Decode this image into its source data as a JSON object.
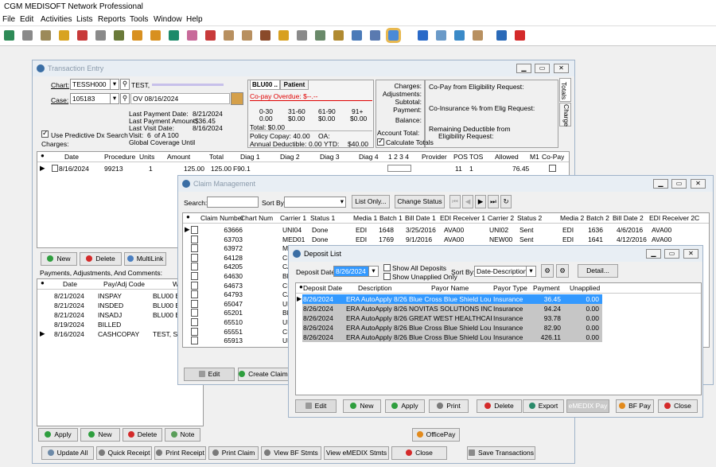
{
  "app": {
    "title": "CGM MEDISOFT Network Professional"
  },
  "menu": [
    "File",
    "Edit",
    "Activities",
    "Lists",
    "Reports",
    "Tools",
    "Window",
    "Help"
  ],
  "toolbar_icons": [
    "quick-ledger-icon",
    "transaction-entry-icon",
    "claim-management-icon",
    "statement-icon",
    "collection-icon",
    "appointment-icon",
    "patient-icon",
    "insurance-icon",
    "address-icon",
    "procedure-icon",
    "diagnosis-icon",
    "provider-icon",
    "referring-icon",
    "billing-code-icon",
    "clipboard-icon",
    "group-icon",
    "tools-icon",
    "calculator-icon",
    "deposit-icon",
    "report-icon",
    "reminder-icon",
    "office-icon",
    "help-icon",
    "document-icon",
    "office-link-icon",
    "export-icon",
    "internet-icon",
    "exit-icon"
  ],
  "te": {
    "title": "Transaction Entry",
    "chart_label": "Chart:",
    "chart_value": "TESSH000",
    "patient_name": "TEST,",
    "case_label": "Case:",
    "case_value": "105183",
    "case_desc": "OV 08/16/2024",
    "last_payment_date_label": "Last Payment Date:",
    "last_payment_date": "8/21/2024",
    "last_payment_amount_label": "Last Payment Amount:",
    "last_payment_amount": "-$36.45",
    "last_visit_date_label": "Last Visit Date:",
    "last_visit_date": "8/16/2024",
    "visit_label": "Visit:",
    "visit_num": "6",
    "visit_of": "of A 100",
    "global_coverage": "Global Coverage Until",
    "predictive_label": "Use Predictive Dx Search",
    "charges_label": "Charges:",
    "tab_blu": "BLU00 ..",
    "tab_patient": "Patient",
    "copay_overdue": "Co-pay Overdue: $--.--",
    "aging_headers": [
      "0-30",
      "31-60",
      "61-90",
      "91+"
    ],
    "aging_values": [
      "0.00",
      "$0.00",
      "$0.00",
      "$0.00"
    ],
    "total": "Total: $0.00",
    "policy_copay": "Policy Copay: 40.00",
    "oa": "OA:",
    "annual_deductible": "Annual Deductible:",
    "deductible_value": "0.00",
    "ytd": "YTD:",
    "ytd_value": "$40.00",
    "sum_labels": [
      "Charges:",
      "Adjustments:",
      "Subtotal:",
      "Payment:",
      "Balance:"
    ],
    "account_total": "Account Total:",
    "calculate_totals": "Calculate Totals",
    "elig1": "Co-Pay from Eligibility Request:",
    "elig2": "Co-Insurance % from Elig Request:",
    "elig3": "Remaining Deductible from",
    "elig4": "Eligibility Request:",
    "side_tab_totals": "Totals",
    "side_tab_charge": "Charge",
    "charge_headers": [
      "Date",
      "Procedure",
      "Units",
      "Amount",
      "Total",
      "Diag 1",
      "Diag 2",
      "Diag 3",
      "Diag 4",
      "1 2 3 4",
      "Provider",
      "POS",
      "TOS",
      "Allowed",
      "M1",
      "Co-Pay"
    ],
    "charge_row": {
      "date": "8/16/2024",
      "procedure": "99213",
      "units": "1",
      "amount": "125.00",
      "total": "125.00",
      "diag1": "F90.1",
      "pos": "11",
      "tos": "1",
      "allowed": "76.45"
    },
    "charge_buttons": [
      "New",
      "Delete",
      "MultiLink"
    ],
    "payments_label": "Payments, Adjustments, And Comments:",
    "payment_headers": [
      "Date",
      "Pay/Adj Code",
      "W"
    ],
    "payments": [
      {
        "date": "8/21/2024",
        "code": "INSPAY",
        "who": "BLU00 BL"
      },
      {
        "date": "8/21/2024",
        "code": "INSDED",
        "who": "BLU00 BL"
      },
      {
        "date": "8/21/2024",
        "code": "INSADJ",
        "who": "BLU00 BL"
      },
      {
        "date": "8/19/2024",
        "code": "BILLED",
        "who": ""
      },
      {
        "date": "8/16/2024",
        "code": "CASHCOPAY",
        "who": "TEST, SH"
      }
    ],
    "payment_buttons": [
      "Apply",
      "New",
      "Delete",
      "Note"
    ],
    "officepay": "OfficePay",
    "bottom_buttons": [
      "Update All",
      "Quick Receipt",
      "Print Receipt",
      "Print Claim",
      "View BF Stmts",
      "View eMEDIX Stmts",
      "Close",
      "Save Transactions"
    ]
  },
  "cm": {
    "title": "Claim Management",
    "search_label": "Search:",
    "sortby_label": "Sort By:",
    "list_only": "List Only...",
    "change_status": "Change Status",
    "headers": [
      "Claim Number",
      "Chart Num",
      "Carrier 1",
      "Status 1",
      "Media 1",
      "Batch 1",
      "Bill Date 1",
      "EDI Receiver 1",
      "Carrier 2",
      "Status 2",
      "Media 2",
      "Batch 2",
      "Bill Date 2",
      "EDI Receiver 2",
      "C"
    ],
    "rows": [
      {
        "claim": "63666",
        "carrier1": "UNI04",
        "status1": "Done",
        "media1": "EDI",
        "batch1": "1648",
        "bill1": "3/25/2016",
        "edi1": "AVA00",
        "carrier2": "UNI02",
        "status2": "Sent",
        "media2": "EDI",
        "batch2": "1636",
        "bill2": "4/6/2016",
        "edi2": "AVA00"
      },
      {
        "claim": "63703",
        "carrier1": "MED01",
        "status1": "Done",
        "media1": "EDI",
        "batch1": "1769",
        "bill1": "9/1/2016",
        "edi1": "AVA00",
        "carrier2": "NEW00",
        "status2": "Sent",
        "media2": "EDI",
        "batch2": "1641",
        "bill2": "4/12/2016",
        "edi2": "AVA00"
      },
      {
        "claim": "63972",
        "carrier1": "ME"
      },
      {
        "claim": "64128",
        "carrier1": "CIC"
      },
      {
        "claim": "64205",
        "carrier1": "CA"
      },
      {
        "claim": "64630",
        "carrier1": "BL"
      },
      {
        "claim": "64673",
        "carrier1": "CIC"
      },
      {
        "claim": "64793",
        "carrier1": "CA"
      },
      {
        "claim": "65047",
        "carrier1": "UN"
      },
      {
        "claim": "65201",
        "carrier1": "BL"
      },
      {
        "claim": "65510",
        "carrier1": "UN"
      },
      {
        "claim": "65551",
        "carrier1": "CIC"
      },
      {
        "claim": "65913",
        "carrier1": "UB"
      }
    ],
    "edit": "Edit",
    "create_claims": "Create Claims"
  },
  "dl": {
    "title": "Deposit List",
    "deposit_date_label": "Deposit Date:",
    "deposit_date": "8/26/2024",
    "show_all": "Show All Deposits",
    "show_unapplied": "Show Unapplied Only",
    "sortby_label": "Sort By:",
    "sortby_value": "Date-Description",
    "detail": "Detail...",
    "headers": [
      "Deposit Date",
      "Description",
      "Payor Name",
      "Payor Type",
      "Payment",
      "Unapplied"
    ],
    "rows": [
      {
        "date": "8/26/2024",
        "desc": "ERA AutoApply 8/26/20",
        "payor": "Blue Cross Blue Shield Louisia",
        "type": "Insurance",
        "payment": "36.45",
        "unapplied": "0.00"
      },
      {
        "date": "8/26/2024",
        "desc": "ERA AutoApply 8/26/20",
        "payor": "NOVITAS SOLUTIONS INC",
        "type": "Insurance",
        "payment": "94.24",
        "unapplied": "0.00"
      },
      {
        "date": "8/26/2024",
        "desc": "ERA AutoApply 8/26/20",
        "payor": "GREAT WEST HEALTHCARE",
        "type": "Insurance",
        "payment": "93.78",
        "unapplied": "0.00"
      },
      {
        "date": "8/26/2024",
        "desc": "ERA AutoApply 8/26/20",
        "payor": "Blue Cross Blue Shield Louisia",
        "type": "Insurance",
        "payment": "82.90",
        "unapplied": "0.00"
      },
      {
        "date": "8/26/2024",
        "desc": "ERA AutoApply 8/26/20",
        "payor": "Blue Cross Blue Shield Louisia",
        "type": "Insurance",
        "payment": "426.11",
        "unapplied": "0.00"
      }
    ],
    "buttons": [
      "Edit",
      "New",
      "Apply",
      "Print",
      "Delete",
      "Export",
      "eMEDIX Pay",
      "BF Pay",
      "Close"
    ]
  },
  "colors": {
    "selected_row": "#3399ff",
    "row_gray": "#c6c6c6",
    "copay_overdue": "#e00000",
    "window_border": "#9fb3c9"
  }
}
